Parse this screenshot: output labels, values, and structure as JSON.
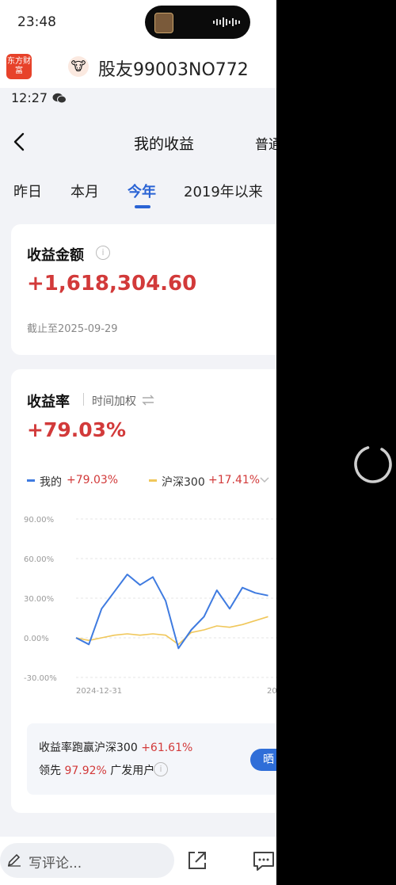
{
  "status_bar": {
    "time": "23:48"
  },
  "app_header": {
    "logo_text": "东方财富",
    "username": "股友99003NO772"
  },
  "sub_status": {
    "time": "12:27"
  },
  "nav": {
    "title": "我的收益",
    "right_label": "普通"
  },
  "tabs": [
    {
      "label": "昨日",
      "active": false
    },
    {
      "label": "本月",
      "active": false
    },
    {
      "label": "今年",
      "active": true
    },
    {
      "label": "2019年以来",
      "active": false
    }
  ],
  "profit_card": {
    "title": "收益金额",
    "amount": "+1,618,304.60",
    "as_of": "截止至2025-09-29"
  },
  "rate_card": {
    "title": "收益率",
    "mode_label": "时间加权",
    "rate": "+79.03%",
    "legend": [
      {
        "label": "我的",
        "value": "+79.03%",
        "color": "#3f7be0"
      },
      {
        "label": "沪深300",
        "value": "+17.41%",
        "color": "#f0c75a"
      }
    ],
    "summary_line1_label": "收益率跑赢沪深300",
    "summary_line1_value": "+61.61%",
    "summary_line2_prefix": "领先",
    "summary_line2_value": "97.92%",
    "summary_line2_suffix": "广发用户",
    "share_button": "晒"
  },
  "chart_data": {
    "type": "line",
    "x": [
      "2024-12-31",
      "2025-01-15",
      "2025-02-01",
      "2025-02-15",
      "2025-03-01",
      "2025-03-15",
      "2025-04-01",
      "2025-04-08",
      "2025-04-15",
      "2025-05-01",
      "2025-05-15",
      "2025-06-01",
      "2025-06-15",
      "2025-07-01",
      "2025-07-15",
      "2025-08-01"
    ],
    "x_tick_labels": [
      "2024-12-31",
      "20"
    ],
    "series": [
      {
        "name": "我的",
        "values": [
          0,
          -5,
          22,
          35,
          48,
          40,
          46,
          28,
          -8,
          6,
          16,
          36,
          22,
          38,
          34,
          32
        ]
      },
      {
        "name": "沪深300",
        "values": [
          0,
          -2,
          0,
          2,
          3,
          2,
          3,
          2,
          -5,
          4,
          6,
          9,
          8,
          10,
          13,
          16
        ]
      }
    ],
    "y_tick_labels": [
      "90.00%",
      "60.00%",
      "30.00%",
      "0.00%",
      "-30.00%"
    ],
    "ylim": [
      -30,
      90
    ],
    "colors": {
      "mine": "#3f7be0",
      "hs300": "#f0c75a"
    }
  },
  "bottom_bar": {
    "comment_placeholder": "写评论..."
  },
  "icons": [
    "back-icon",
    "info-icon",
    "swap-icon",
    "chevron-down-icon",
    "pencil-icon",
    "share-icon",
    "comment-icon",
    "wechat-icon",
    "loading-spinner"
  ]
}
